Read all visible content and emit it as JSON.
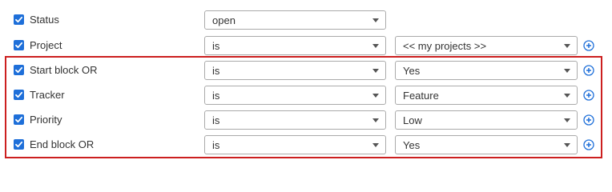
{
  "filters": [
    {
      "label": "Status",
      "checked": true,
      "operator": "open",
      "value": null,
      "has_add": false
    },
    {
      "label": "Project",
      "checked": true,
      "operator": "is",
      "value": "<< my projects >>",
      "has_add": true
    },
    {
      "label": "Start block OR",
      "checked": true,
      "operator": "is",
      "value": "Yes",
      "has_add": true
    },
    {
      "label": "Tracker",
      "checked": true,
      "operator": "is",
      "value": "Feature",
      "has_add": true
    },
    {
      "label": "Priority",
      "checked": true,
      "operator": "is",
      "value": "Low",
      "has_add": true
    },
    {
      "label": "End block OR",
      "checked": true,
      "operator": "is",
      "value": "Yes",
      "has_add": true
    }
  ],
  "icons": {
    "checkbox": "checkmark-icon",
    "add": "plus-circle-icon",
    "dropdown": "chevron-down-icon"
  },
  "colors": {
    "checkbox": "#1e6fd9",
    "highlight_frame": "#cc1f1f",
    "add_icon": "#1e6fd9"
  }
}
